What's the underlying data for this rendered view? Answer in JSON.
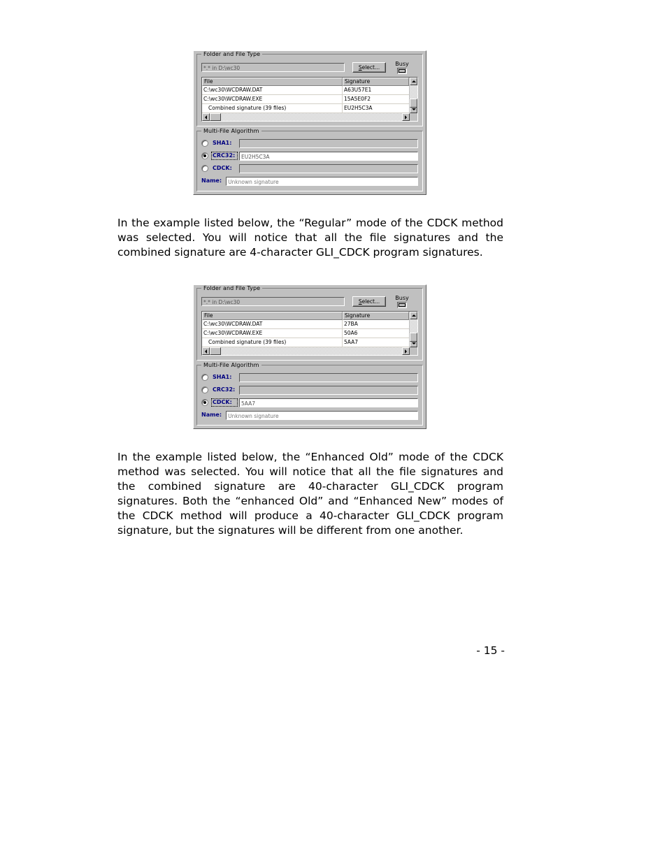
{
  "page": {
    "number_label": "- 15 -"
  },
  "paragraphs": {
    "first": "In the example listed below, the “Regular” mode of the CDCK method was selected. You will notice that all the file signatures and the combined signature are 4-character GLI_CDCK program signatures.",
    "second": "In the example listed below, the “Enhanced Old” mode of the CDCK method was selected. You will notice that all the file signatures and the combined signature are 40-character GLI_CDCK program signatures. Both the “enhanced Old” and “Enhanced New” modes of the CDCK method will produce a 40-character GLI_CDCK program signature, but the signatures will be different from one another."
  },
  "colors": {
    "dialog_face": "#c0c0c0",
    "label_navy": "#000080",
    "field_white": "#ffffff",
    "shadow": "#5a5a5a"
  },
  "figure_1": {
    "folder_group": {
      "title": "Folder and File Type",
      "path_value": "*.* in D:\\wc30",
      "path_placeholder": "*.* in D:\\wc30",
      "select_button": "Select...",
      "select_accesskey": "S",
      "busy_label": "Busy"
    },
    "file_list": {
      "columns": [
        "File",
        "Signature"
      ],
      "rows": [
        {
          "file": "C:\\wc30\\WCDRAW.DAT",
          "signature": "A63U57E1",
          "indent": false
        },
        {
          "file": "C:\\wc30\\WCDRAW.EXE",
          "signature": "15A5E0F2",
          "indent": false
        },
        {
          "file": "Combined signature (39 files)",
          "signature": "EU2H5C3A",
          "indent": true
        }
      ]
    },
    "algorithm_group": {
      "title": "Multi-File Algorithm",
      "options": [
        {
          "label": "SHA1:",
          "value": "",
          "selected": false,
          "focused": false
        },
        {
          "label": "CRC32:",
          "value": "EU2H5C3A",
          "selected": true,
          "focused": true
        },
        {
          "label": "CDCK:",
          "value": "",
          "selected": false,
          "focused": false
        }
      ],
      "name_label": "Name:",
      "name_value": "Unknown signature"
    }
  },
  "figure_2": {
    "folder_group": {
      "title": "Folder and File Type",
      "path_value": "*.* in D:\\wc30",
      "path_placeholder": "*.* in D:\\wc30",
      "select_button": "Select...",
      "select_accesskey": "S",
      "busy_label": "Busy"
    },
    "file_list": {
      "columns": [
        "File",
        "Signature"
      ],
      "rows": [
        {
          "file": "C:\\wc30\\WCDRAW.DAT",
          "signature": "27BA",
          "indent": false
        },
        {
          "file": "C:\\wc30\\WCDRAW.EXE",
          "signature": "50A6",
          "indent": false
        },
        {
          "file": "Combined signature (39 files)",
          "signature": "5AA7",
          "indent": true
        }
      ]
    },
    "algorithm_group": {
      "title": "Multi-File Algorithm",
      "options": [
        {
          "label": "SHA1:",
          "value": "",
          "selected": false,
          "focused": false
        },
        {
          "label": "CRC32:",
          "value": "",
          "selected": false,
          "focused": false
        },
        {
          "label": "CDCK:",
          "value": "5AA7",
          "selected": true,
          "focused": true
        }
      ],
      "name_label": "Name:",
      "name_value": "Unknown signature"
    }
  }
}
